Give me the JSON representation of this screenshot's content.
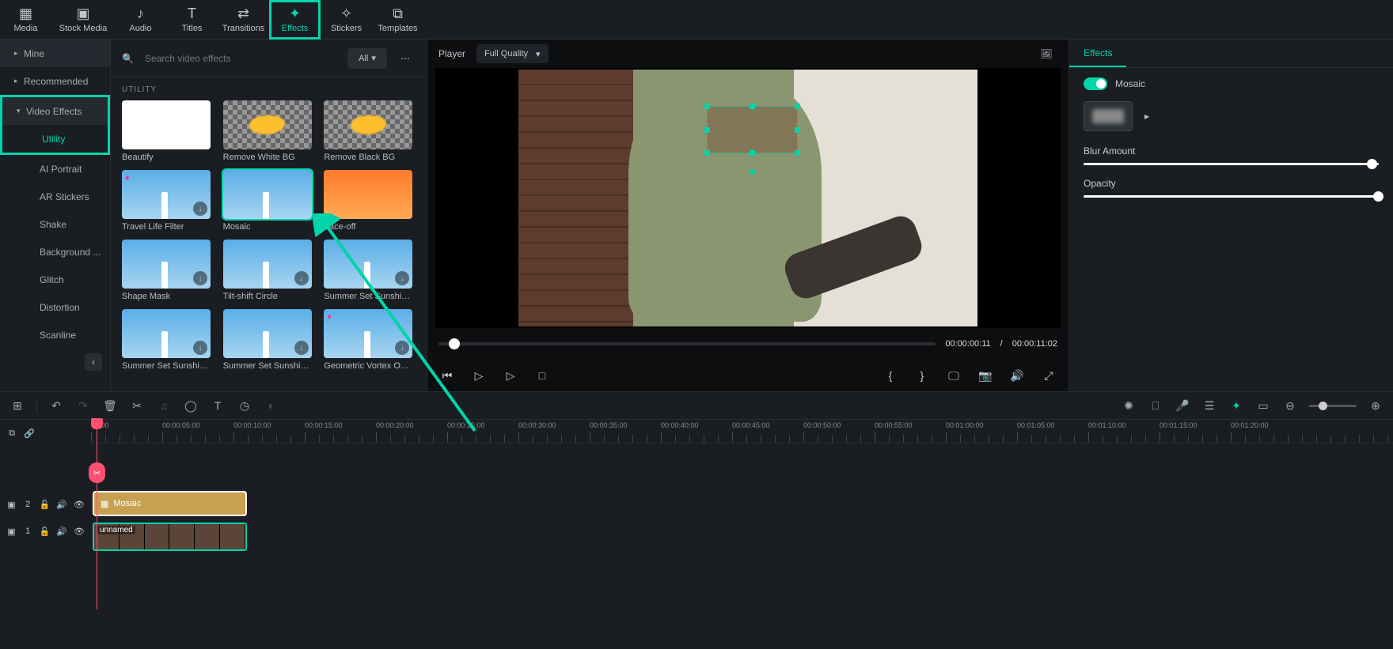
{
  "topTabs": [
    {
      "id": "media",
      "label": "Media"
    },
    {
      "id": "stock",
      "label": "Stock Media"
    },
    {
      "id": "audio",
      "label": "Audio"
    },
    {
      "id": "titles",
      "label": "Titles"
    },
    {
      "id": "transitions",
      "label": "Transitions"
    },
    {
      "id": "effects",
      "label": "Effects",
      "active": true
    },
    {
      "id": "stickers",
      "label": "Stickers"
    },
    {
      "id": "templates",
      "label": "Templates"
    }
  ],
  "sidebar": {
    "mine": "Mine",
    "recommended": "Recommended",
    "videoEffects": "Video Effects",
    "utility": "Utility",
    "aiPortrait": "AI Portrait",
    "arStickers": "AR Stickers",
    "shake": "Shake",
    "background": "Background ...",
    "glitch": "Glitch",
    "distortion": "Distortion",
    "scanline": "Scanline"
  },
  "effectsHeader": {
    "searchPlaceholder": "Search video effects",
    "filter": "All"
  },
  "effectsSection": "UTILITY",
  "effects": [
    {
      "label": "Beautify",
      "thumb": "white",
      "gem": false,
      "dl": false
    },
    {
      "label": "Remove White BG",
      "thumb": "checker",
      "gem": false,
      "dl": false,
      "yellow": true
    },
    {
      "label": "Remove Black BG",
      "thumb": "checker",
      "gem": false,
      "dl": false,
      "yellow": true
    },
    {
      "label": "Travel Life Filter",
      "thumb": "sky",
      "gem": true,
      "dl": true
    },
    {
      "label": "Mosaic",
      "thumb": "sky",
      "gem": false,
      "dl": false,
      "selected": true
    },
    {
      "label": "Face-off",
      "thumb": "orange",
      "gem": false,
      "dl": false
    },
    {
      "label": "Shape Mask",
      "thumb": "sky",
      "gem": false,
      "dl": true
    },
    {
      "label": "Tilt-shift Circle",
      "thumb": "sky",
      "gem": false,
      "dl": true
    },
    {
      "label": "Summer Set Sunshine ...",
      "thumb": "sky",
      "gem": false,
      "dl": true
    },
    {
      "label": "Summer Set Sunshine ...",
      "thumb": "sky",
      "gem": false,
      "dl": true
    },
    {
      "label": "Summer Set Sunshine ...",
      "thumb": "sky",
      "gem": false,
      "dl": true
    },
    {
      "label": "Geometric Vortex Ove...",
      "thumb": "sky",
      "gem": true,
      "dl": true
    }
  ],
  "player": {
    "label": "Player",
    "quality": "Full Quality",
    "current": "00:00:00:11",
    "sep": "/",
    "duration": "00:00:11:02"
  },
  "props": {
    "tab": "Effects",
    "title": "Mosaic",
    "blurLabel": "Blur Amount",
    "opacityLabel": "Opacity"
  },
  "ruler": [
    "00:00",
    "00:00:05:00",
    "00:00:10:00",
    "00:00:15:00",
    "00:00:20:00",
    "00:00:25:00",
    "00:00:30:00",
    "00:00:35:00",
    "00:00:40:00",
    "00:00:45:00",
    "00:00:50:00",
    "00:00:55:00",
    "00:01:00:00",
    "00:01:05:00",
    "00:01:10:00",
    "00:01:15:00",
    "00:01:20:00"
  ],
  "tracks": {
    "effectClip": "Mosaic",
    "videoClip": "unnamed",
    "lane2": "2",
    "lane1": "1"
  }
}
